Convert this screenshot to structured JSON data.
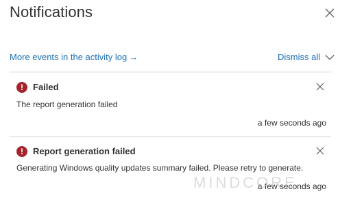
{
  "header": {
    "title": "Notifications",
    "close_icon": "close-icon"
  },
  "toolbar": {
    "activity_link_label": "More events in the activity log",
    "activity_link_arrow": "→",
    "dismiss_all_label": "Dismiss all",
    "collapse_icon": "chevron-down-icon"
  },
  "notifications": [
    {
      "status": "error",
      "status_icon": "error-icon",
      "status_icon_glyph": "!",
      "title": "Failed",
      "body": "The report generation failed",
      "time": "a few seconds ago",
      "dismiss_icon": "close-icon"
    },
    {
      "status": "error",
      "status_icon": "error-icon",
      "status_icon_glyph": "!",
      "title": "Report generation failed",
      "body": "Generating Windows quality updates summary failed. Please retry to generate.",
      "time": "a few seconds ago",
      "dismiss_icon": "close-icon"
    }
  ],
  "watermark": "MINDCORE",
  "colors": {
    "link": "#1a6fb5",
    "error": "#a4262c",
    "divider": "#d2d0ce",
    "text": "#323130"
  }
}
